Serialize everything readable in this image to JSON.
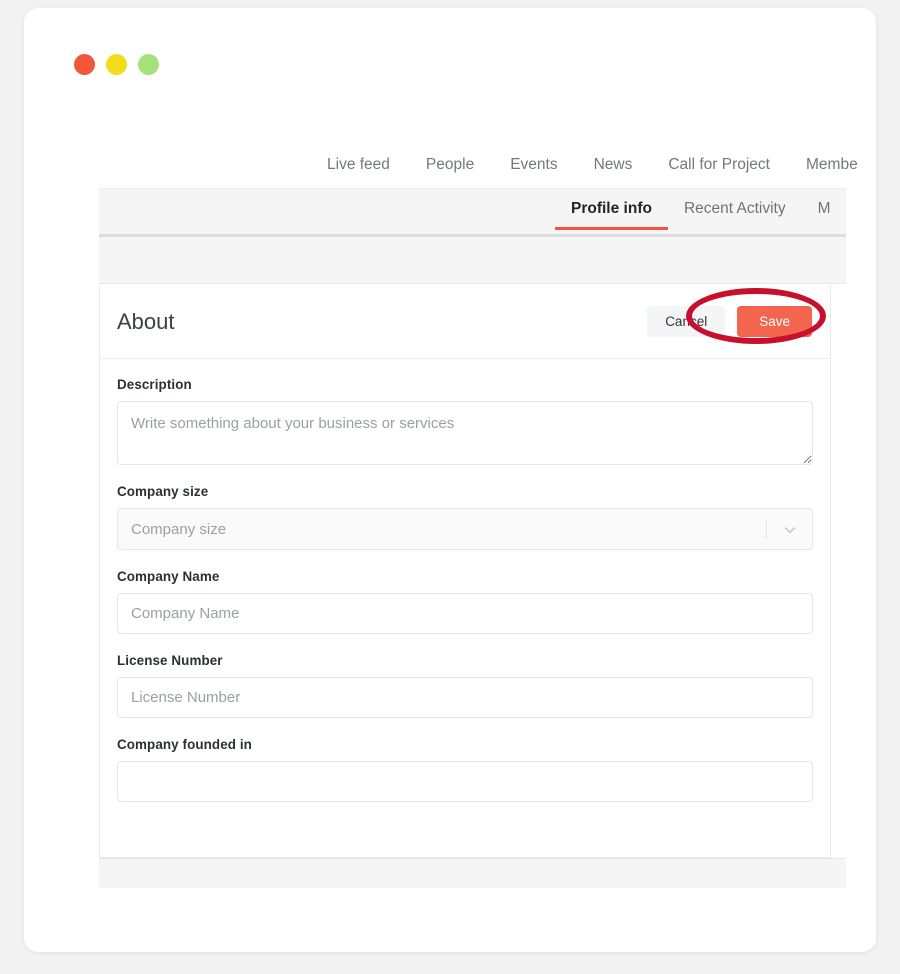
{
  "window": {
    "controls": [
      {
        "name": "close",
        "color": "#f4563c"
      },
      {
        "name": "minimize",
        "color": "#f2dc1c"
      },
      {
        "name": "maximize",
        "color": "#a6e07a"
      }
    ]
  },
  "main_nav": {
    "items": [
      {
        "label": "Live feed",
        "active": false
      },
      {
        "label": "People",
        "active": false
      },
      {
        "label": "Events",
        "active": false
      },
      {
        "label": "News",
        "active": false
      },
      {
        "label": "Call for Project",
        "active": false
      },
      {
        "label": "Membe",
        "active": false
      }
    ]
  },
  "tabs": {
    "items": [
      {
        "label": "Profile info",
        "active": true
      },
      {
        "label": "Recent Activity",
        "active": false
      },
      {
        "label": "M",
        "active": false
      }
    ],
    "active_underline_color": "#f4543a"
  },
  "card": {
    "title": "About",
    "cancel_label": "Cancel",
    "save_label": "Save",
    "save_color": "#f4654e"
  },
  "form": {
    "description": {
      "label": "Description",
      "placeholder": "Write something about your business or services",
      "value": ""
    },
    "company_size": {
      "label": "Company size",
      "placeholder": "Company size",
      "value": "Company size"
    },
    "company_name": {
      "label": "Company Name",
      "placeholder": "Company Name",
      "value": ""
    },
    "license_number": {
      "label": "License Number",
      "placeholder": "License Number",
      "value": ""
    },
    "company_founded": {
      "label": "Company founded in",
      "placeholder": "",
      "value": ""
    }
  },
  "annotation": {
    "shape": "ellipse",
    "color": "#c8102e",
    "target": "save-button"
  }
}
